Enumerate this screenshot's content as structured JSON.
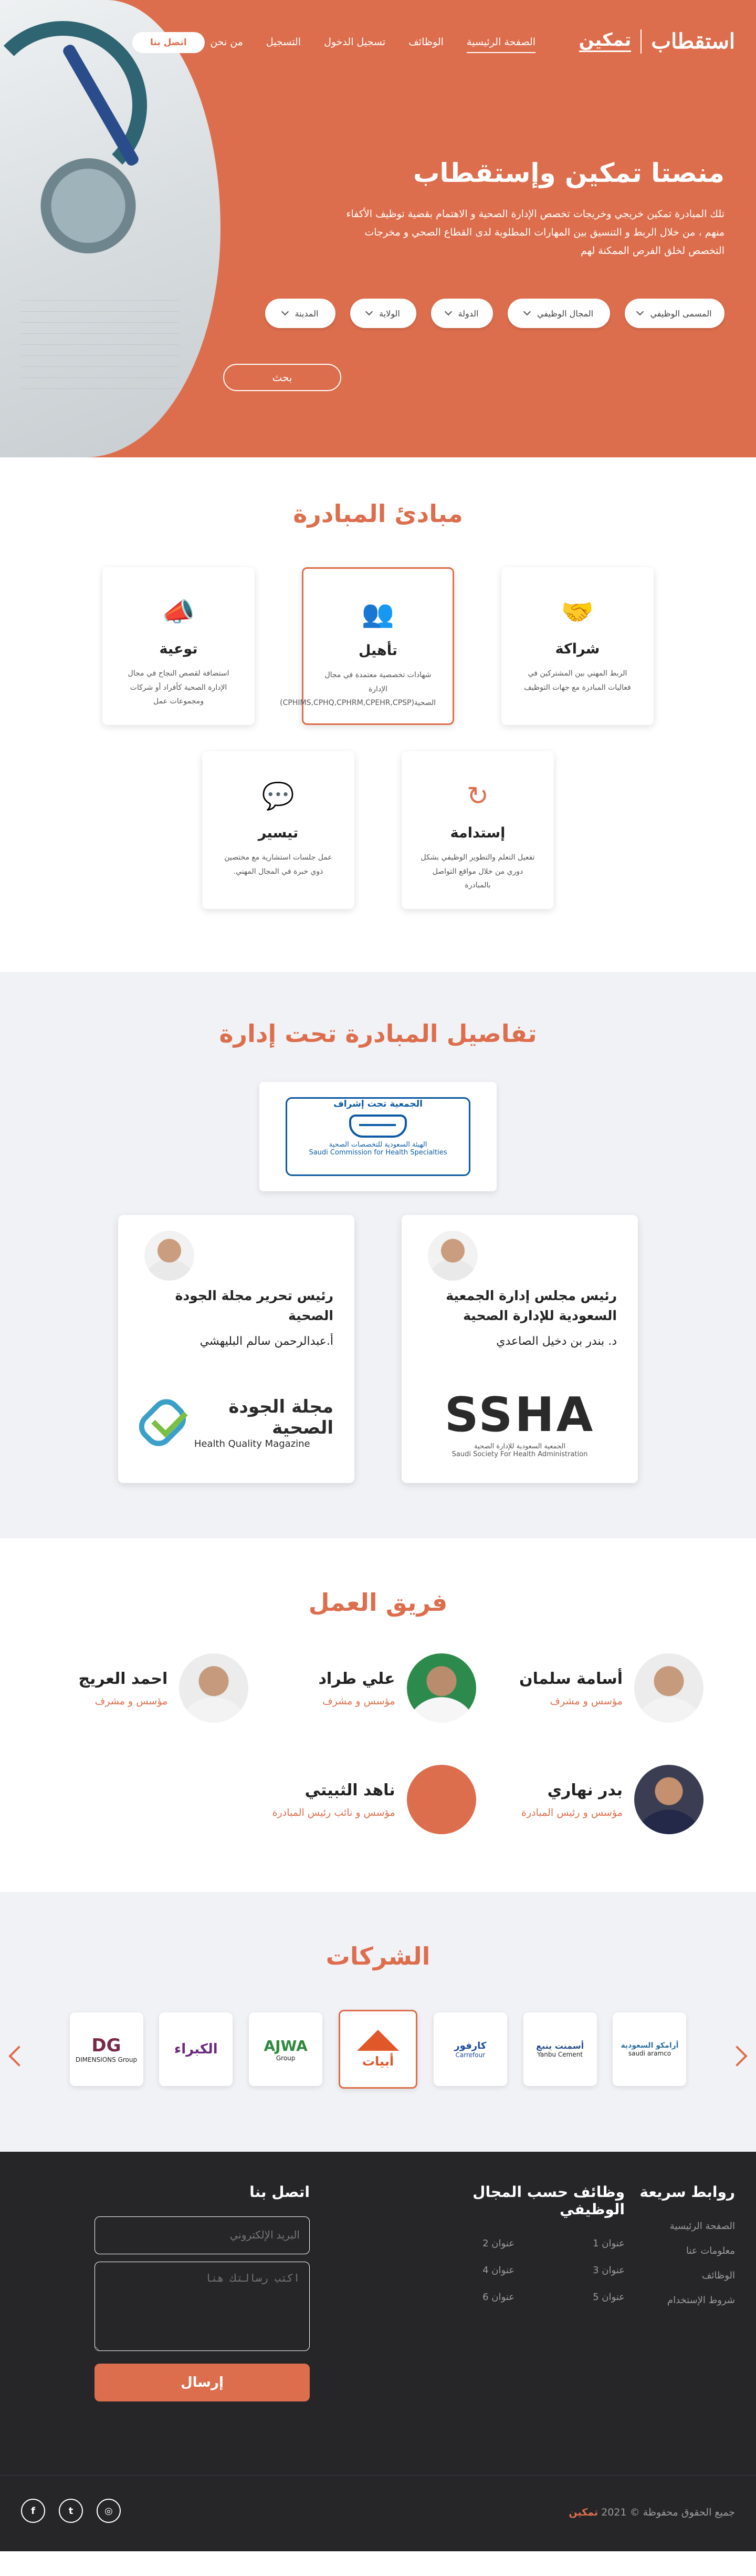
{
  "nav": {
    "brand_primary": "استقطاب",
    "brand_secondary": "تمكين",
    "items": [
      {
        "label": "الصفحة الرئيسية",
        "active": true
      },
      {
        "label": "الوظائف",
        "active": false
      },
      {
        "label": "تسجيل الدخول",
        "active": false
      },
      {
        "label": "التسجيل",
        "active": false
      },
      {
        "label": "من نحن",
        "active": false
      }
    ],
    "contact_label": "اتصل بنا"
  },
  "hero": {
    "title": "منصتا تمكين وإستقطاب",
    "text": "تلك المبادرة تمكين خريجي وخريجات تخصص الإدارة الصحية و الاهتمام بقضية توظيف الأكفاء منهم ، من خلال الربط و التنسيق بين المهارات المطلوبة لدى القطاع الصحي و مخرجات التخصص لخلق الفرص الممكنة لهم",
    "filters": [
      {
        "label": "المسمى الوظيفي"
      },
      {
        "label": "المجال الوظيفي"
      },
      {
        "label": "الدولة"
      },
      {
        "label": "الولاية"
      },
      {
        "label": "المدينة"
      }
    ],
    "search_label": "بحث"
  },
  "principles": {
    "title": "مبادئ المبادرة",
    "cards": [
      {
        "icon": "handshake-icon",
        "glyph": "🤝",
        "title": "شراكة",
        "text": "الربط المهني بين المشتركين في فعاليات المبادرة مع جهات التوظيف",
        "highlight": false
      },
      {
        "icon": "users-icon",
        "glyph": "👥",
        "title": "تأهيل",
        "text": "شهادات تخصصية معتمدة في مجال الإدارة الصحية(CPHIMS,CPHQ,CPHRM,CPEHR,CPSP)",
        "highlight": true
      },
      {
        "icon": "megaphone-icon",
        "glyph": "📣",
        "title": "توعية",
        "text": "استضافة لقصص النجاح في مجال الإدارة الصحية كأفراد أو شركات ومجموعات عمل",
        "highlight": false
      },
      {
        "icon": "refresh-icon",
        "glyph": "↻",
        "title": "إستدامة",
        "text": "تفعيل التعلم والتطوير الوظيفي بشكل دوري من خلال مواقع التواصل بالمبادرة",
        "highlight": false
      },
      {
        "icon": "chat-icon",
        "glyph": "💬",
        "title": "تيسير",
        "text": "عمل جلسات استشارية مع مختصين ذوي خبرة في المجال المهني.",
        "highlight": false
      }
    ]
  },
  "details": {
    "title": "تفاصيل المبادرة تحت إدارة",
    "supervision_label": "الجمعية تحت إشراف",
    "commission_ar": "الهيئة السعودية للتخصصات الصحية",
    "commission_en": "Saudi Commission for Health Specialties",
    "people": [
      {
        "role": "رئيس مجلس إدارة الجمعية السعودية للإدارة الصحية",
        "name": "د. بندر بن دخيل الصاعدي",
        "logo_main": "SSHA",
        "logo_sub_ar": "الجمعية السعودية للإدارة الصحية",
        "logo_sub_en": "Saudi Society For Health Administration"
      },
      {
        "role": "رئيس تحرير مجلة الجودة الصحية",
        "name": "أ.عبدالرحمن سالم البليهشي",
        "logo_main": "مجلة الجودة الصحية",
        "logo_sub_en": "Health Quality Magazine"
      }
    ]
  },
  "team": {
    "title": "فريق العمل",
    "members": [
      {
        "name": "أسامة سلمان",
        "role": "مؤسس و مشرف",
        "avatar": "light"
      },
      {
        "name": "علي طراد",
        "role": "مؤسس و مشرف",
        "avatar": "green"
      },
      {
        "name": "احمد العريج",
        "role": "مؤسس و مشرف",
        "avatar": "light"
      },
      {
        "name": "بدر نهاري",
        "role": "مؤسس و رئيس المبادرة",
        "avatar": "dark"
      },
      {
        "name": "ناهد الثبيتي",
        "role": "مؤسس و نائب رئيس المبادرة",
        "avatar": "blank"
      }
    ]
  },
  "companies": {
    "title": "الشركات",
    "logos": [
      {
        "big": "DG",
        "small": "DIMENSIONS Group",
        "color": "#7a2a48",
        "highlight": false
      },
      {
        "big": "الكبراء",
        "small": "",
        "color": "#6b2a7e",
        "highlight": false
      },
      {
        "big": "AJWA",
        "small": "Group",
        "color": "#2f8a3e",
        "highlight": false
      },
      {
        "big": "أبيات",
        "small": "",
        "color": "#e0572a",
        "highlight": true
      },
      {
        "big": "كارفور",
        "small": "Carrefour",
        "color": "#1c4aa0",
        "highlight": false
      },
      {
        "big": "أسمنت ينبع",
        "small": "Yanbu Cement",
        "color": "#2a4f8e",
        "highlight": false
      },
      {
        "big": "أرامكو السعودية",
        "small": "saudi aramco",
        "color": "#2a6f9e",
        "highlight": false
      }
    ]
  },
  "footer": {
    "quick_title": "روابط سريعة",
    "quick_links": [
      "الصفحة الرئيسية",
      "معلومات عنا",
      "الوظائف",
      "شروط الإستخدام"
    ],
    "jobs_title": "وظائف حسب المجال الوظيفي",
    "job_links": [
      "عنوان 1",
      "عنوان 2",
      "عنوان 3",
      "عنوان 4",
      "عنوان 5",
      "عنوان 6"
    ],
    "contact_title": "اتصل بنا",
    "email_placeholder": "البريد الإلكتروني",
    "message_placeholder": "اكتب رسالتك هنا",
    "send_label": "إرسال",
    "brand": "تمكين",
    "copyright": "جميع الحقوق محفوظة © 2021"
  },
  "colors": {
    "accent": "#dd6e4d",
    "footer_bg": "#262629",
    "light_bg": "#f1f2f6"
  }
}
